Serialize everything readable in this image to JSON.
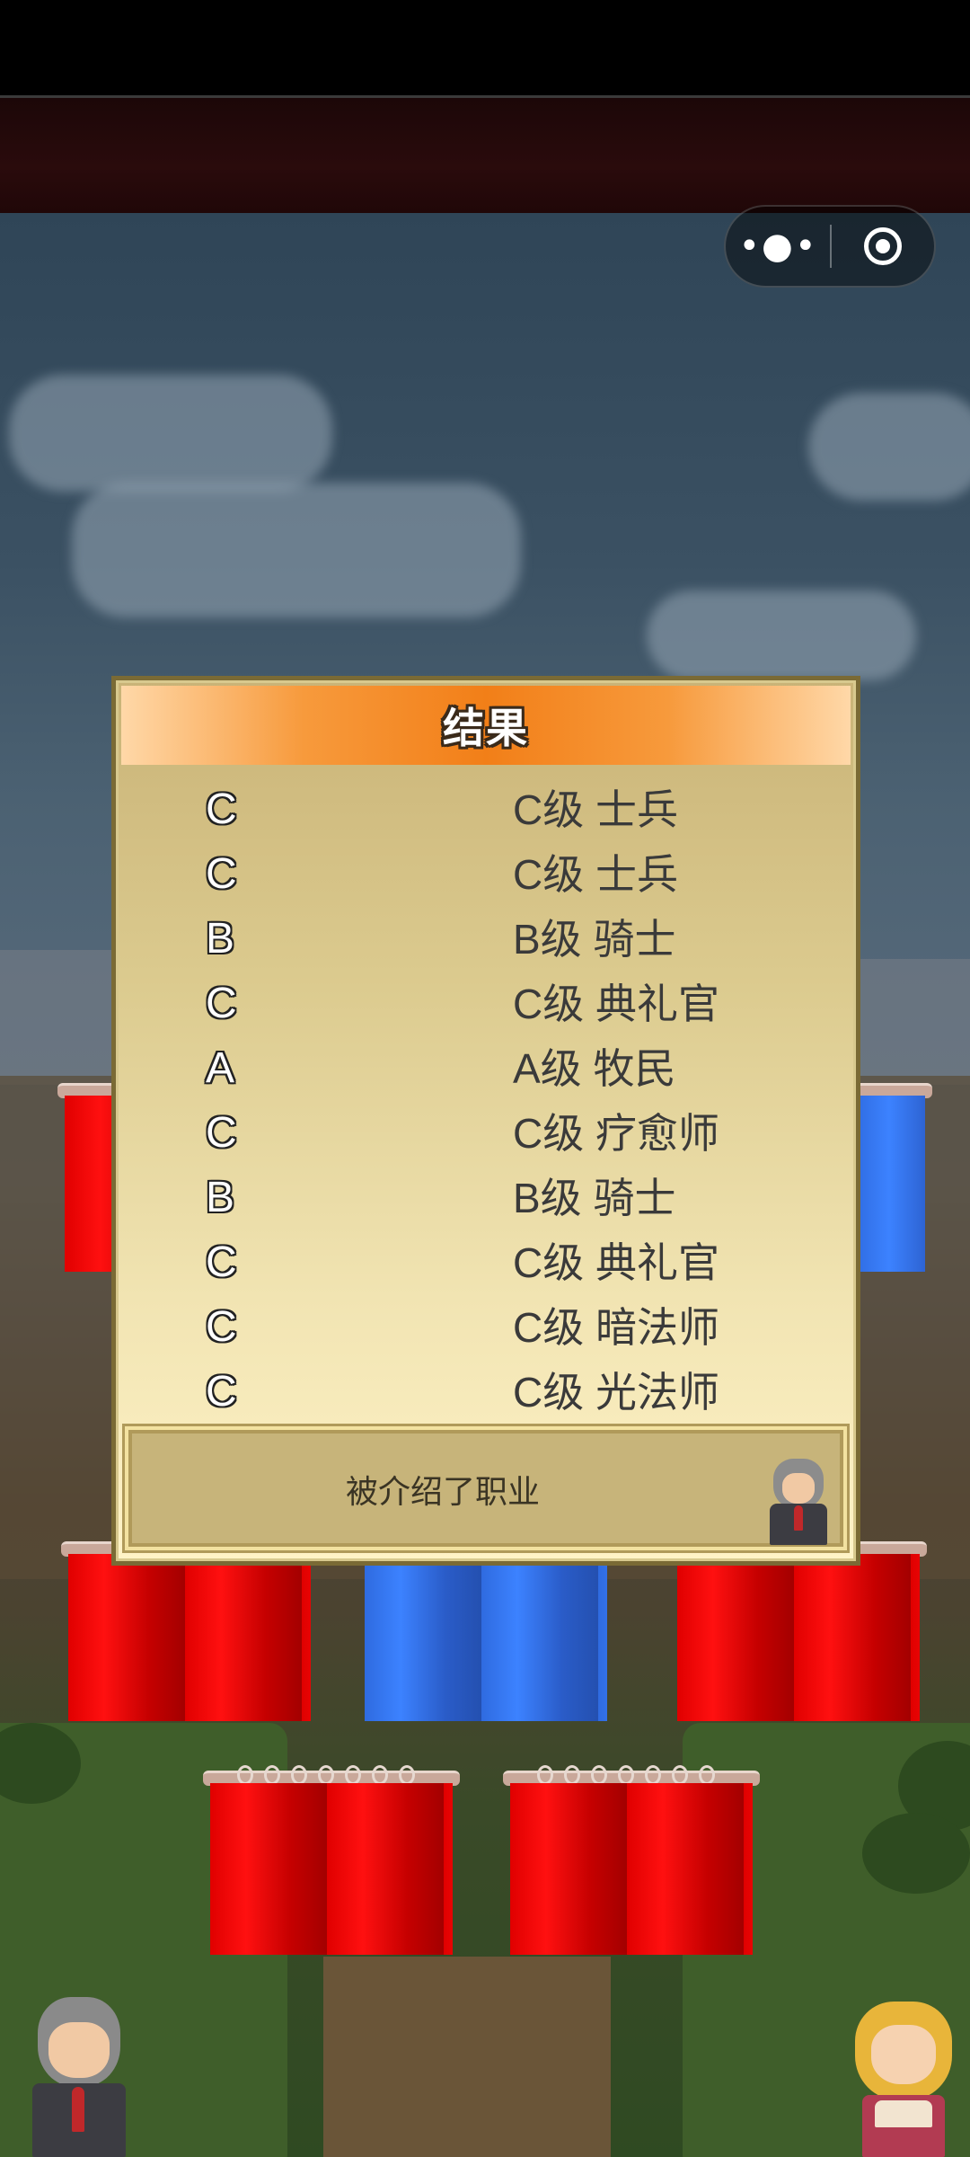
{
  "wechat_capsule": {
    "more_icon": "more-dots-icon",
    "close_icon": "target-close-icon"
  },
  "dialog": {
    "title": "结果",
    "results": [
      {
        "grade": "C",
        "job": "C级 士兵"
      },
      {
        "grade": "C",
        "job": "C级 士兵"
      },
      {
        "grade": "B",
        "job": "B级 骑士"
      },
      {
        "grade": "C",
        "job": "C级 典礼官"
      },
      {
        "grade": "A",
        "job": "A级 牧民"
      },
      {
        "grade": "C",
        "job": "C级 疗愈师"
      },
      {
        "grade": "B",
        "job": "B级 骑士"
      },
      {
        "grade": "C",
        "job": "C级 典礼官"
      },
      {
        "grade": "C",
        "job": "C级 暗法师"
      },
      {
        "grade": "C",
        "job": "C级 光法师"
      }
    ],
    "message": "被介绍了职业"
  },
  "colors": {
    "header_orange": "#f27f18",
    "dialog_cream": "#fff3c7",
    "curtain_red": "#e00000",
    "curtain_blue": "#3c82ff"
  }
}
